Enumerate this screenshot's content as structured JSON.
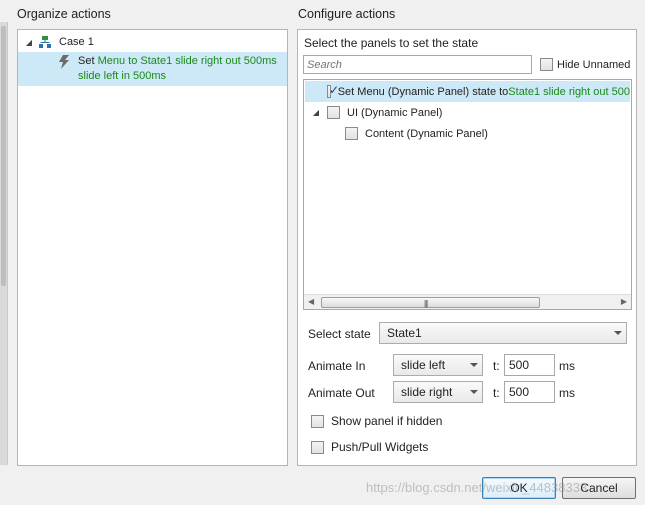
{
  "organize": {
    "title": "Organize actions",
    "case_label": "Case 1",
    "action": {
      "prefix": "Set ",
      "line1_detail": "Menu to State1 slide right out 500ms",
      "line2_detail": "slide left in 500ms"
    }
  },
  "configure": {
    "title": "Configure actions",
    "select_panels_label": "Select the panels to set the state",
    "search_placeholder": "Search",
    "hide_unnamed_label": "Hide Unnamed",
    "tree": [
      {
        "label": "Set Menu (Dynamic Panel) state to ",
        "detail": "State1 slide right out 500",
        "checked": true,
        "selected": true
      },
      {
        "label": "UI (Dynamic Panel)",
        "checked": false,
        "expanded": true
      },
      {
        "label": "Content (Dynamic Panel)",
        "checked": false
      }
    ],
    "select_state_label": "Select state",
    "select_state_value": "State1",
    "animate_in_label": "Animate In",
    "animate_in_value": "slide left",
    "animate_in_t_label": "t:",
    "animate_in_t": "500",
    "animate_in_unit": "ms",
    "animate_out_label": "Animate Out",
    "animate_out_value": "slide right",
    "animate_out_t_label": "t:",
    "animate_out_t": "500",
    "animate_out_unit": "ms",
    "show_panel_label": "Show panel if hidden",
    "push_pull_label": "Push/Pull Widgets"
  },
  "buttons": {
    "ok": "OK",
    "cancel": "Cancel"
  },
  "watermark": "https://blog.csdn.net/weixin_44838333",
  "colors": {
    "selection": "#cde8f6",
    "action_detail": "#1a8a1a",
    "ok_border": "#3c7fb1"
  },
  "icons": {
    "case": "case-flow-icon",
    "action": "lightning-bolt-icon"
  }
}
